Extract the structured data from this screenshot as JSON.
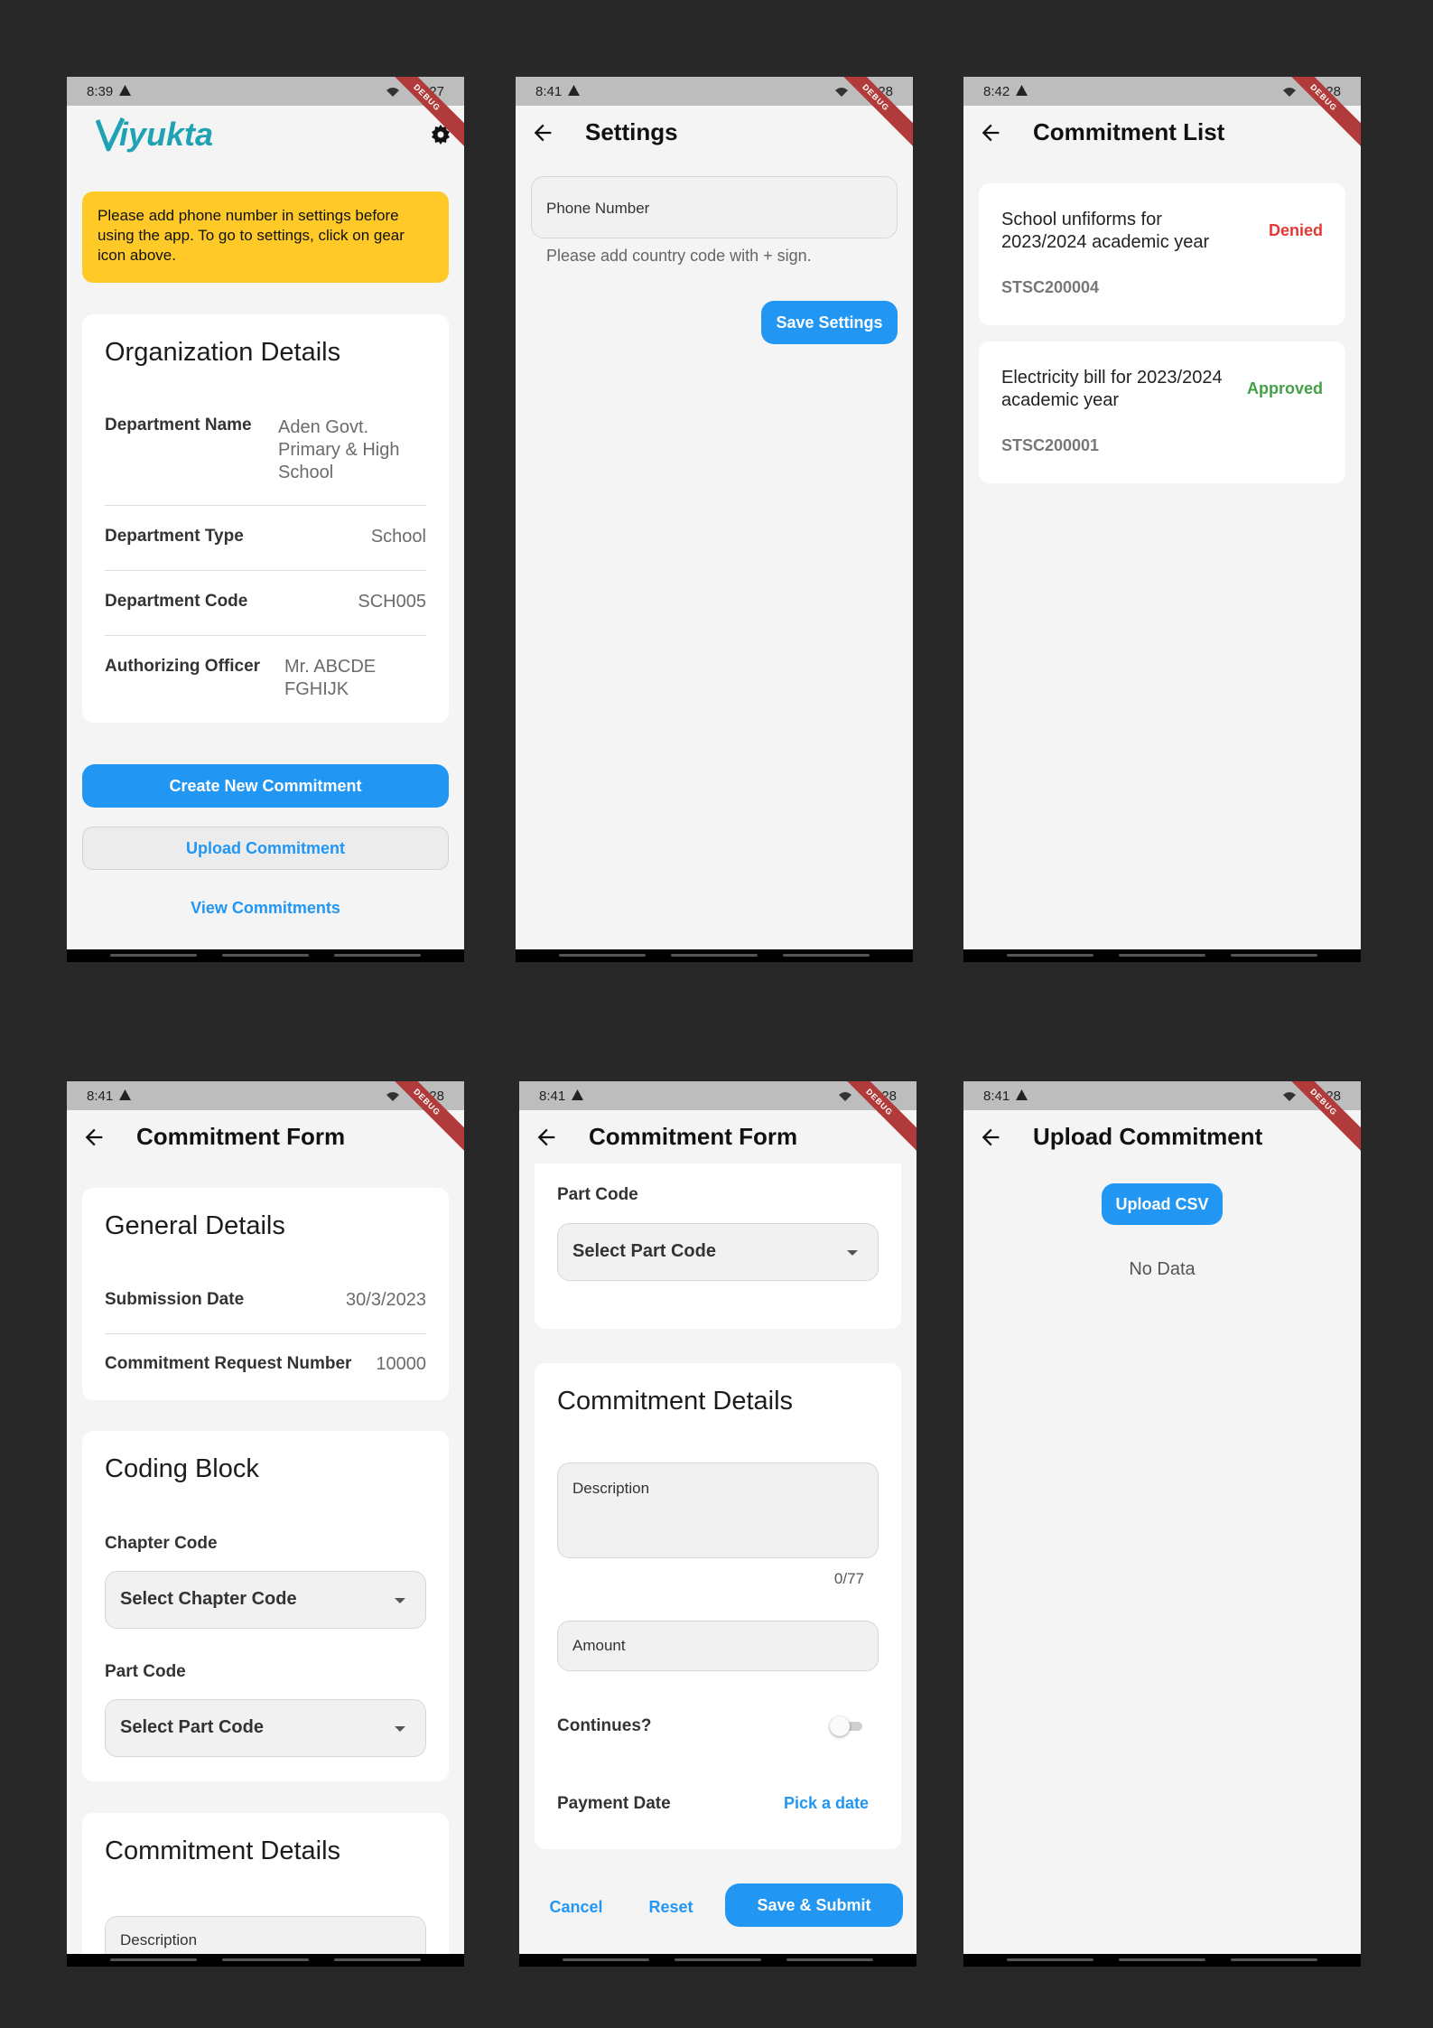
{
  "status_bars": [
    {
      "time": "8:39",
      "battery": "27"
    },
    {
      "time": "8:41",
      "battery": "28"
    },
    {
      "time": "8:42",
      "battery": "28"
    },
    {
      "time": "8:41",
      "battery": "28"
    },
    {
      "time": "8:41",
      "battery": "28"
    },
    {
      "time": "8:41",
      "battery": "28"
    }
  ],
  "debug_banner": "DEBUG",
  "home": {
    "logo_text": "Viyukta",
    "alert": "Please add phone number in settings before using the app. To go to settings, click on gear icon above.",
    "org_card": {
      "title": "Organization Details",
      "rows": [
        {
          "label": "Department Name",
          "value": "Aden Govt. Primary & High School"
        },
        {
          "label": "Department Type",
          "value": "School"
        },
        {
          "label": "Department Code",
          "value": "SCH005"
        },
        {
          "label": "Authorizing Officer",
          "value": "Mr. ABCDE FGHIJK"
        }
      ]
    },
    "create_button": "Create New Commitment",
    "upload_button": "Upload Commitment",
    "view_link": "View Commitments"
  },
  "settings": {
    "title": "Settings",
    "phone_placeholder": "Phone Number",
    "helper": "Please add country code with + sign.",
    "save_button": "Save Settings"
  },
  "commitment_list": {
    "title": "Commitment List",
    "items": [
      {
        "title": "School unfiforms for 2023/2024 academic year",
        "status": "Denied",
        "code": "STSC200004"
      },
      {
        "title": "Electricity bill for 2023/2024 academic year",
        "status": "Approved",
        "code": "STSC200001"
      }
    ]
  },
  "commitment_form": {
    "title": "Commitment Form",
    "general": {
      "title": "General Details",
      "submission_label": "Submission Date",
      "submission_value": "30/3/2023",
      "request_label": "Commitment Request Number",
      "request_value": "10000"
    },
    "coding": {
      "title": "Coding Block",
      "chapter_label": "Chapter Code",
      "chapter_placeholder": "Select Chapter Code",
      "part_label": "Part Code",
      "part_placeholder": "Select Part Code"
    },
    "details": {
      "title": "Commitment Details",
      "description_placeholder": "Description",
      "char_counter": "0/77",
      "amount_placeholder": "Amount",
      "continues_label": "Continues?",
      "continues_value": false,
      "payment_label": "Payment Date",
      "pick_date": "Pick a date"
    },
    "actions": {
      "cancel": "Cancel",
      "reset": "Reset",
      "submit": "Save & Submit"
    }
  },
  "upload": {
    "title": "Upload Commitment",
    "button": "Upload CSV",
    "empty": "No Data"
  },
  "colors": {
    "primary": "#2196f3",
    "alert": "#ffca28",
    "denied": "#e53935",
    "approved": "#43a047",
    "logo": "#1fa3b4"
  }
}
